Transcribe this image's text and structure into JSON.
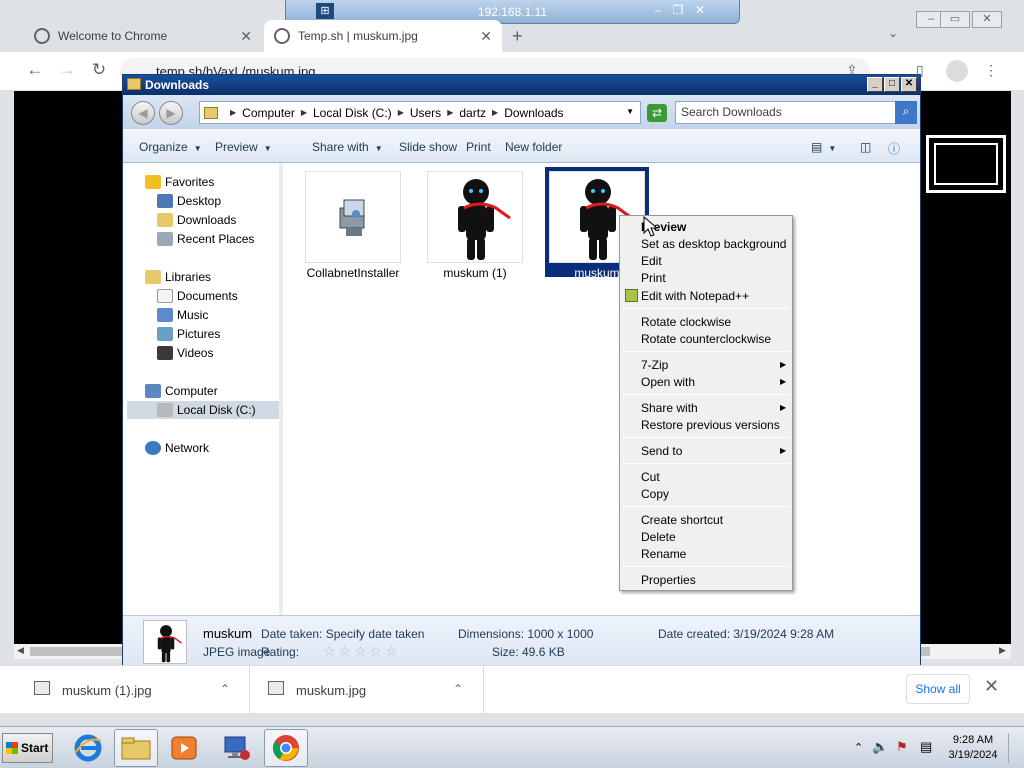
{
  "rdp": {
    "host": "192.168.1.11",
    "pin_icon": "pin-icon"
  },
  "browser": {
    "tabs": [
      {
        "title": "Welcome to Chrome",
        "close": "✕"
      },
      {
        "title": "Temp.sh | muskum.jpg",
        "close": "✕"
      }
    ],
    "new_tab": "+",
    "url": "temp.sh/bVaxL/muskum.jpg"
  },
  "explorer": {
    "title": "Downloads",
    "breadcrumbs": [
      "Computer",
      "Local Disk (C:)",
      "Users",
      "dartz",
      "Downloads"
    ],
    "search_placeholder": "Search Downloads",
    "commands": [
      "Organize",
      "Preview",
      "Share with",
      "Slide show",
      "Print",
      "New folder"
    ],
    "nav": {
      "favorites": "Favorites",
      "favorites_items": [
        "Desktop",
        "Downloads",
        "Recent Places"
      ],
      "libraries": "Libraries",
      "libraries_items": [
        "Documents",
        "Music",
        "Pictures",
        "Videos"
      ],
      "computer": "Computer",
      "computer_items": [
        "Local Disk (C:)"
      ],
      "network": "Network"
    },
    "files": [
      "CollabnetInstaller",
      "muskum (1)",
      "muskum"
    ],
    "details": {
      "name": "muskum",
      "type": "JPEG image",
      "date_taken": "Date taken: Specify date taken",
      "rating_label": "Rating:",
      "stars": "☆☆☆☆☆",
      "dimensions": "Dimensions: 1000 x 1000",
      "size": "Size: 49.6 KB",
      "created": "Date created: 3/19/2024 9:28 AM"
    }
  },
  "context_menu": {
    "items": [
      "Preview",
      "Set as desktop background",
      "Edit",
      "Print",
      "Edit with Notepad++",
      "Rotate clockwise",
      "Rotate counterclockwise",
      "7-Zip",
      "Open with",
      "Share with",
      "Restore previous versions",
      "Send to",
      "Cut",
      "Copy",
      "Create shortcut",
      "Delete",
      "Rename",
      "Properties"
    ]
  },
  "downloads": {
    "items": [
      "muskum (1).jpg",
      "muskum.jpg"
    ],
    "show_all": "Show all"
  },
  "taskbar": {
    "start": "Start",
    "time": "9:28 AM",
    "date": "3/19/2024"
  }
}
